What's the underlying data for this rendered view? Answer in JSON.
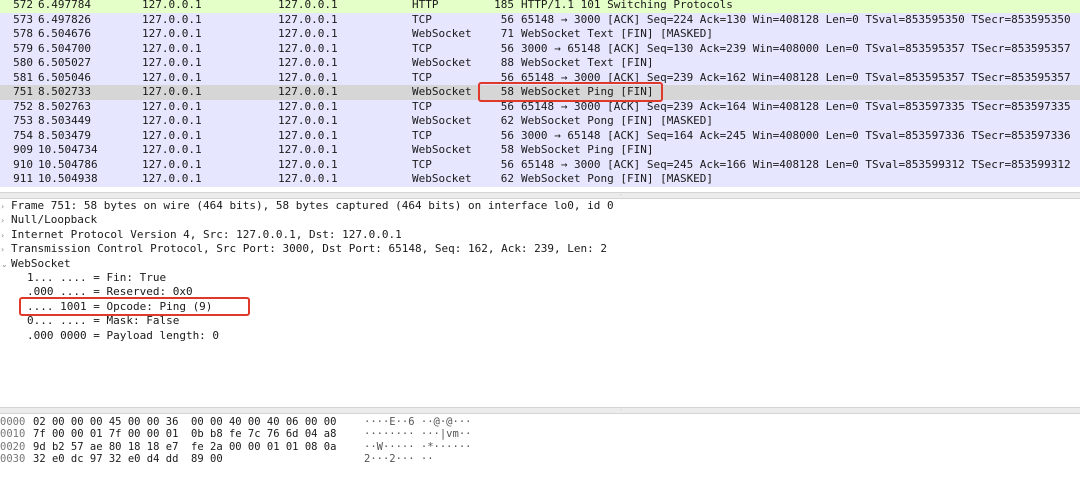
{
  "packet_list": {
    "rows": [
      {
        "no": "572",
        "time": "6.497784",
        "src": "127.0.0.1",
        "dst": "127.0.0.1",
        "proto": "HTTP",
        "len": "185",
        "info": "HTTP/1.1 101 Switching Protocols",
        "bg": "#e4ffc7"
      },
      {
        "no": "573",
        "time": "6.497826",
        "src": "127.0.0.1",
        "dst": "127.0.0.1",
        "proto": "TCP",
        "len": "56",
        "info": "65148 → 3000 [ACK] Seq=224 Ack=130 Win=408128 Len=0 TSval=853595350 TSecr=853595350",
        "bg": "#e7e6ff"
      },
      {
        "no": "578",
        "time": "6.504676",
        "src": "127.0.0.1",
        "dst": "127.0.0.1",
        "proto": "WebSocket",
        "len": "71",
        "info": "WebSocket Text [FIN] [MASKED]",
        "bg": "#e7e6ff"
      },
      {
        "no": "579",
        "time": "6.504700",
        "src": "127.0.0.1",
        "dst": "127.0.0.1",
        "proto": "TCP",
        "len": "56",
        "info": "3000 → 65148 [ACK] Seq=130 Ack=239 Win=408000 Len=0 TSval=853595357 TSecr=853595357",
        "bg": "#e7e6ff"
      },
      {
        "no": "580",
        "time": "6.505027",
        "src": "127.0.0.1",
        "dst": "127.0.0.1",
        "proto": "WebSocket",
        "len": "88",
        "info": "WebSocket Text [FIN]",
        "bg": "#e7e6ff"
      },
      {
        "no": "581",
        "time": "6.505046",
        "src": "127.0.0.1",
        "dst": "127.0.0.1",
        "proto": "TCP",
        "len": "56",
        "info": "65148 → 3000 [ACK] Seq=239 Ack=162 Win=408128 Len=0 TSval=853595357 TSecr=853595357",
        "bg": "#e7e6ff"
      },
      {
        "no": "751",
        "time": "8.502733",
        "src": "127.0.0.1",
        "dst": "127.0.0.1",
        "proto": "WebSocket",
        "len": "58",
        "info": "WebSocket Ping [FIN]",
        "bg": "#d6d6d6"
      },
      {
        "no": "752",
        "time": "8.502763",
        "src": "127.0.0.1",
        "dst": "127.0.0.1",
        "proto": "TCP",
        "len": "56",
        "info": "65148 → 3000 [ACK] Seq=239 Ack=164 Win=408128 Len=0 TSval=853597335 TSecr=853597335",
        "bg": "#e7e6ff"
      },
      {
        "no": "753",
        "time": "8.503449",
        "src": "127.0.0.1",
        "dst": "127.0.0.1",
        "proto": "WebSocket",
        "len": "62",
        "info": "WebSocket Pong [FIN] [MASKED]",
        "bg": "#e7e6ff"
      },
      {
        "no": "754",
        "time": "8.503479",
        "src": "127.0.0.1",
        "dst": "127.0.0.1",
        "proto": "TCP",
        "len": "56",
        "info": "3000 → 65148 [ACK] Seq=164 Ack=245 Win=408000 Len=0 TSval=853597336 TSecr=853597336",
        "bg": "#e7e6ff"
      },
      {
        "no": "909",
        "time": "10.504734",
        "src": "127.0.0.1",
        "dst": "127.0.0.1",
        "proto": "WebSocket",
        "len": "58",
        "info": "WebSocket Ping [FIN]",
        "bg": "#e7e6ff"
      },
      {
        "no": "910",
        "time": "10.504786",
        "src": "127.0.0.1",
        "dst": "127.0.0.1",
        "proto": "TCP",
        "len": "56",
        "info": "65148 → 3000 [ACK] Seq=245 Ack=166 Win=408128 Len=0 TSval=853599312 TSecr=853599312",
        "bg": "#e7e6ff"
      },
      {
        "no": "911",
        "time": "10.504938",
        "src": "127.0.0.1",
        "dst": "127.0.0.1",
        "proto": "WebSocket",
        "len": "62",
        "info": "WebSocket Pong [FIN] [MASKED]",
        "bg": "#e7e6ff"
      }
    ]
  },
  "details": {
    "rows": [
      {
        "indent": 0,
        "arrow": "›",
        "text": "Frame 751: 58 bytes on wire (464 bits), 58 bytes captured (464 bits) on interface lo0, id 0"
      },
      {
        "indent": 0,
        "arrow": "›",
        "text": "Null/Loopback"
      },
      {
        "indent": 0,
        "arrow": "›",
        "text": "Internet Protocol Version 4, Src: 127.0.0.1, Dst: 127.0.0.1"
      },
      {
        "indent": 0,
        "arrow": "›",
        "text": "Transmission Control Protocol, Src Port: 3000, Dst Port: 65148, Seq: 162, Ack: 239, Len: 2"
      },
      {
        "indent": 0,
        "arrow": "⌄",
        "text": "WebSocket"
      },
      {
        "indent": 1,
        "arrow": "",
        "text": "1... .... = Fin: True"
      },
      {
        "indent": 1,
        "arrow": "",
        "text": ".000 .... = Reserved: 0x0"
      },
      {
        "indent": 1,
        "arrow": "",
        "text": ".... 1001 = Opcode: Ping (9)"
      },
      {
        "indent": 1,
        "arrow": "",
        "text": "0... .... = Mask: False"
      },
      {
        "indent": 1,
        "arrow": "",
        "text": ".000 0000 = Payload length: 0"
      }
    ]
  },
  "bytes": {
    "rows": [
      {
        "offset": "0000",
        "hex": "02 00 00 00 45 00 00 36  00 00 40 00 40 06 00 00",
        "ascii": "····E··6 ··@·@···"
      },
      {
        "offset": "0010",
        "hex": "7f 00 00 01 7f 00 00 01  0b b8 fe 7c 76 6d 04 a8",
        "ascii": "········ ···|vm··"
      },
      {
        "offset": "0020",
        "hex": "9d b2 57 ae 80 18 18 e7  fe 2a 00 00 01 01 08 0a",
        "ascii": "··W····· ·*······"
      },
      {
        "offset": "0030",
        "hex": "32 e0 dc 97 32 e0 d4 dd  89 00",
        "ascii": "2···2··· ··"
      }
    ]
  },
  "colors": {
    "annotation": "#e0392a",
    "selected_row": "#d6d6d6",
    "websocket_tcp_row": "#e7e6ff",
    "http_row": "#e4ffc7"
  }
}
